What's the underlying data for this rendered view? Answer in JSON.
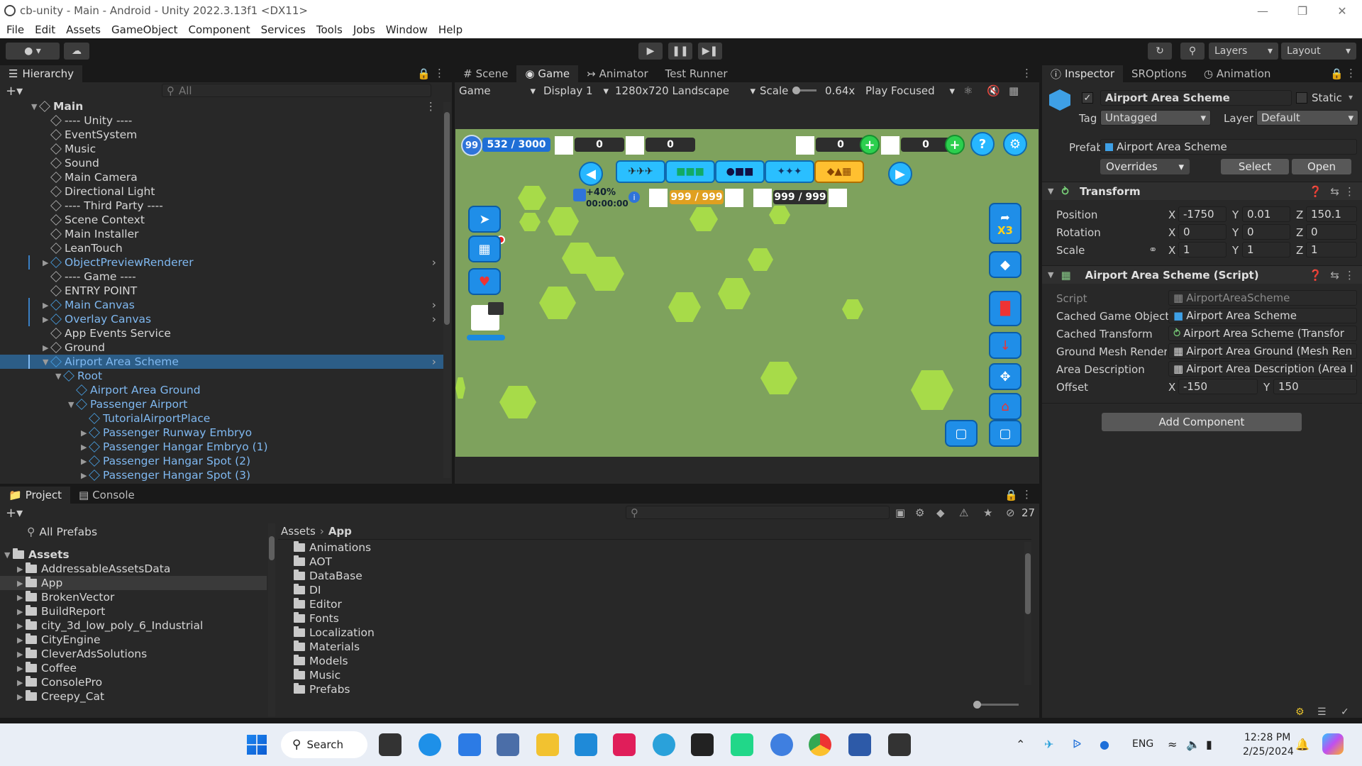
{
  "window": {
    "title": "cb-unity - Main - Android - Unity 2022.3.13f1 <DX11>",
    "controls": [
      "—",
      "❐",
      "✕"
    ]
  },
  "menu": [
    "File",
    "Edit",
    "Assets",
    "GameObject",
    "Component",
    "Services",
    "Tools",
    "Jobs",
    "Window",
    "Help"
  ],
  "toolbar": {
    "layers": "Layers",
    "layout": "Layout"
  },
  "hierarchy": {
    "tab": "Hierarchy",
    "search_placeholder": "All",
    "rows": [
      {
        "label": "Main",
        "depth": 0,
        "caret": "▼",
        "blue": false,
        "sel": false,
        "scene": true
      },
      {
        "label": "---- Unity ----",
        "depth": 1,
        "caret": "",
        "blue": false,
        "sel": false
      },
      {
        "label": "EventSystem",
        "depth": 1,
        "caret": "",
        "blue": false,
        "sel": false
      },
      {
        "label": "Music",
        "depth": 1,
        "caret": "",
        "blue": false,
        "sel": false
      },
      {
        "label": "Sound",
        "depth": 1,
        "caret": "",
        "blue": false,
        "sel": false
      },
      {
        "label": "Main Camera",
        "depth": 1,
        "caret": "",
        "blue": false,
        "sel": false
      },
      {
        "label": "Directional Light",
        "depth": 1,
        "caret": "",
        "blue": false,
        "sel": false
      },
      {
        "label": "---- Third Party ----",
        "depth": 1,
        "caret": "",
        "blue": false,
        "sel": false
      },
      {
        "label": "Scene Context",
        "depth": 1,
        "caret": "",
        "blue": false,
        "sel": false
      },
      {
        "label": "Main Installer",
        "depth": 1,
        "caret": "",
        "blue": false,
        "sel": false
      },
      {
        "label": "LeanTouch",
        "depth": 1,
        "caret": "",
        "blue": false,
        "sel": false
      },
      {
        "label": "ObjectPreviewRenderer",
        "depth": 1,
        "caret": "▶",
        "blue": true,
        "sel": false,
        "more": true
      },
      {
        "label": "---- Game ----",
        "depth": 1,
        "caret": "",
        "blue": false,
        "sel": false
      },
      {
        "label": "ENTRY POINT",
        "depth": 1,
        "caret": "",
        "blue": false,
        "sel": false
      },
      {
        "label": "Main Canvas",
        "depth": 1,
        "caret": "▶",
        "blue": true,
        "sel": false,
        "more": true
      },
      {
        "label": "Overlay Canvas",
        "depth": 1,
        "caret": "▶",
        "blue": true,
        "sel": false,
        "more": true
      },
      {
        "label": "App Events Service",
        "depth": 1,
        "caret": "",
        "blue": false,
        "sel": false
      },
      {
        "label": "Ground",
        "depth": 1,
        "caret": "▶",
        "blue": false,
        "sel": false
      },
      {
        "label": "Airport Area Scheme",
        "depth": 1,
        "caret": "▼",
        "blue": true,
        "sel": true,
        "more": true
      },
      {
        "label": "Root",
        "depth": 2,
        "caret": "▼",
        "blue": true,
        "sel": false
      },
      {
        "label": "Airport Area Ground",
        "depth": 3,
        "caret": "",
        "blue": true,
        "sel": false
      },
      {
        "label": "Passenger Airport",
        "depth": 3,
        "caret": "▼",
        "blue": true,
        "sel": false
      },
      {
        "label": "TutorialAirportPlace",
        "depth": 4,
        "caret": "",
        "blue": true,
        "sel": false
      },
      {
        "label": "Passenger Runway Embryo",
        "depth": 4,
        "caret": "▶",
        "blue": true,
        "sel": false
      },
      {
        "label": "Passenger Hangar Embryo (1)",
        "depth": 4,
        "caret": "▶",
        "blue": true,
        "sel": false
      },
      {
        "label": "Passenger Hangar Spot (2)",
        "depth": 4,
        "caret": "▶",
        "blue": true,
        "sel": false
      },
      {
        "label": "Passenger Hangar Spot (3)",
        "depth": 4,
        "caret": "▶",
        "blue": true,
        "sel": false
      }
    ]
  },
  "center": {
    "tabs": [
      "Scene",
      "Game",
      "Animator",
      "Test Runner"
    ],
    "active_tab": "Game",
    "game_toolbar": {
      "mode": "Game",
      "display": "Display 1",
      "resolution": "1280x720 Landscape",
      "scale_label": "Scale",
      "scale_value": "0.64x",
      "play_mode": "Play Focused"
    },
    "hud": {
      "level": "99",
      "xp": "532 / 3000",
      "counter1": "0",
      "counter2": "0",
      "counter3": "0",
      "counter4": "0",
      "bonus": "+40%",
      "timer": "00:00:00",
      "stock1": "999 / 999",
      "stock2": "999 / 999",
      "multiplier": "X3",
      "help": "?"
    }
  },
  "inspector": {
    "tabs": [
      "Inspector",
      "SROptions",
      "Animation"
    ],
    "object_name": "Airport Area Scheme",
    "static_label": "Static",
    "tag_label": "Tag",
    "tag_value": "Untagged",
    "layer_label": "Layer",
    "layer_value": "Default",
    "prefab_label": "Prefab",
    "prefab_value": "Airport Area Scheme",
    "overrides": "Overrides",
    "select": "Select",
    "open": "Open",
    "transform": {
      "title": "Transform",
      "position_label": "Position",
      "rotation_label": "Rotation",
      "scale_label": "Scale",
      "position": {
        "x": "-1750",
        "y": "0.01",
        "z": "150.1"
      },
      "rotation": {
        "x": "0",
        "y": "0",
        "z": "0"
      },
      "scale": {
        "x": "1",
        "y": "1",
        "z": "1"
      }
    },
    "script_comp": {
      "title": "Airport Area Scheme (Script)",
      "script_label": "Script",
      "script_value": "AirportAreaScheme",
      "f1_label": "Cached Game Object",
      "f1_value": "Airport Area Scheme",
      "f2_label": "Cached Transform",
      "f2_value": "Airport Area Scheme (Transfor",
      "f3_label": "Ground Mesh Render",
      "f3_value": "Airport Area Ground (Mesh Ren",
      "f4_label": "Area Description",
      "f4_value": "Airport Area Description (Area I",
      "offset_label": "Offset",
      "offset_x": "-150",
      "offset_y": "150"
    },
    "add_component": "Add Component",
    "axis": {
      "x": "X",
      "y": "Y",
      "z": "Z"
    }
  },
  "project": {
    "tabs": [
      "Project",
      "Console"
    ],
    "badge": "27",
    "favorites": "All Prefabs",
    "assets_root": "Assets",
    "tree": [
      "AddressableAssetsData",
      "App",
      "BrokenVector",
      "BuildReport",
      "city_3d_low_poly_6_Industrial",
      "CityEngine",
      "CleverAdsSolutions",
      "Coffee",
      "ConsolePro",
      "Creepy_Cat"
    ],
    "breadcrumb": [
      "Assets",
      "App"
    ],
    "folders": [
      "Animations",
      "AOT",
      "DataBase",
      "DI",
      "Editor",
      "Fonts",
      "Localization",
      "Materials",
      "Models",
      "Music",
      "Prefabs"
    ]
  },
  "taskbar": {
    "search": "Search",
    "lang": "ENG",
    "time": "12:28 PM",
    "date": "2/25/2024"
  }
}
